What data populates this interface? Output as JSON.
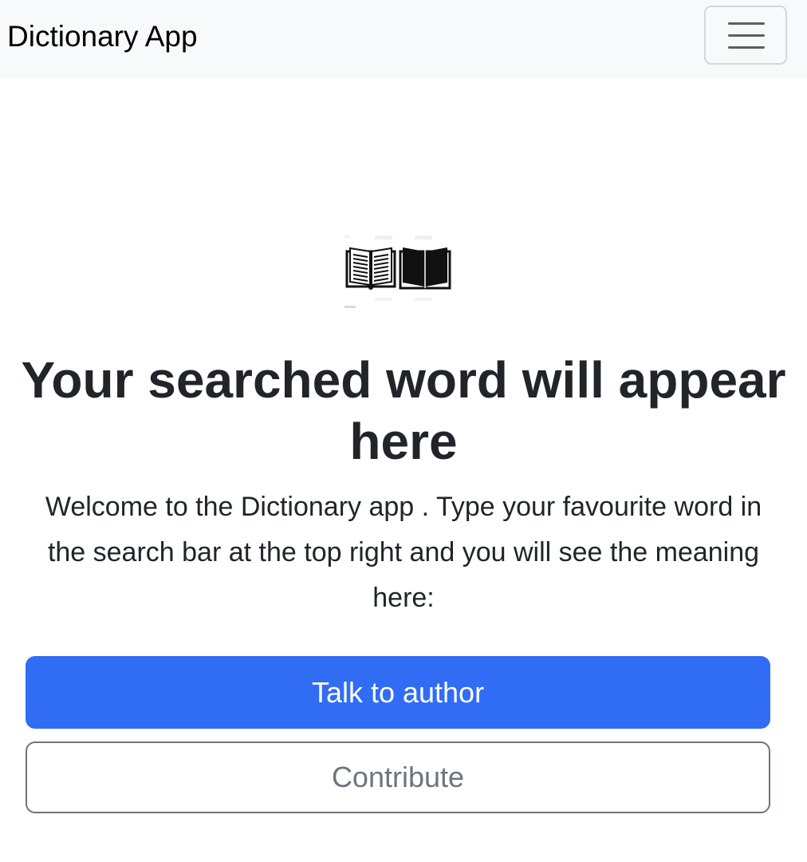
{
  "navbar": {
    "brand": "Dictionary App",
    "toggler_icon": "hamburger-menu-icon"
  },
  "hero": {
    "image_icon": "open-book-icon",
    "headline": "Your searched word will appear here",
    "lead": "Welcome to the Dictionary app . Type your favourite word in the search bar at the top right and you will see the meaning here:"
  },
  "actions": {
    "talk_label": "Talk to author",
    "contribute_label": "Contribute"
  },
  "colors": {
    "navbar_bg": "#f8f9fa",
    "primary": "#316cf4",
    "secondary": "#6c757d",
    "text": "#212529"
  }
}
